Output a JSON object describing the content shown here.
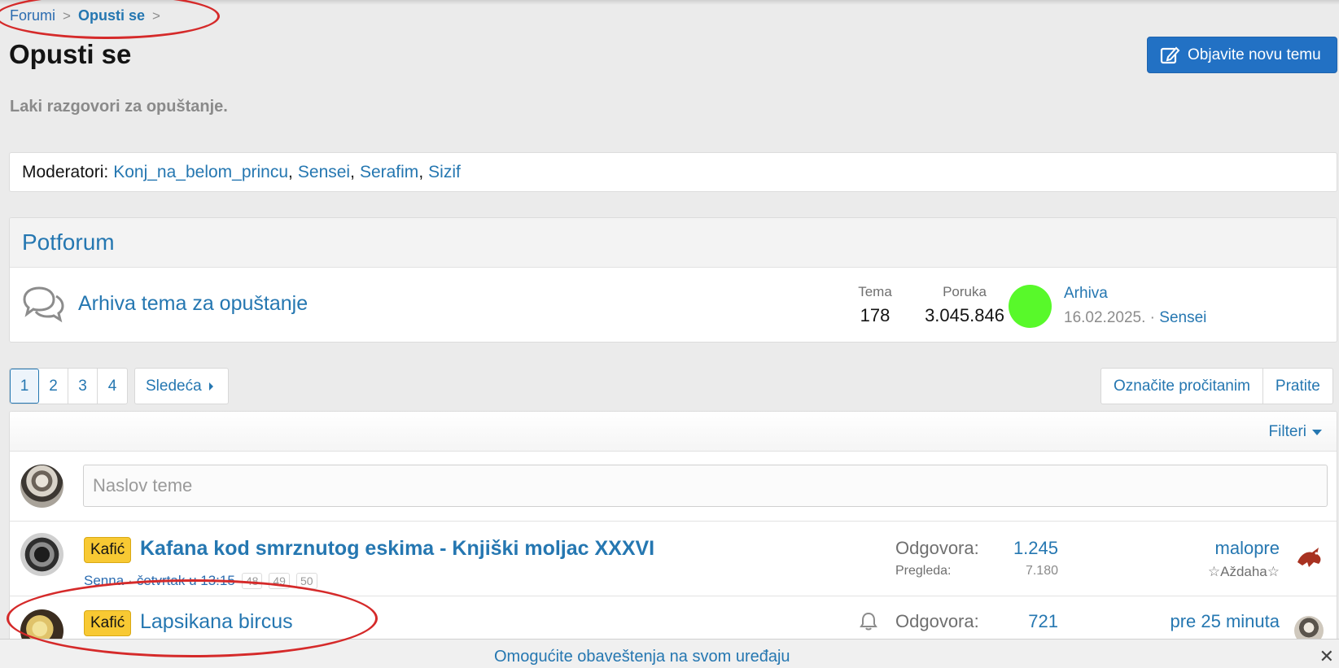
{
  "breadcrumb": {
    "root": "Forumi",
    "current": "Opusti se",
    "separator": ">"
  },
  "page": {
    "title": "Opusti se",
    "new_topic_label": "Objavite novu temu",
    "description": "Laki razgovori za opuštanje."
  },
  "moderators": {
    "label": "Moderatori:",
    "names": [
      "Konj_na_belom_princu",
      "Sensei",
      "Serafim",
      "Sizif"
    ]
  },
  "subforum": {
    "heading": "Potforum",
    "node": {
      "title": "Arhiva tema za opuštanje",
      "tema_label": "Tema",
      "tema_value": "178",
      "poruka_label": "Poruka",
      "poruka_value": "3.045.846",
      "last_title": "Arhiva",
      "last_date": "16.02.2025.",
      "last_user": "Sensei"
    }
  },
  "pagination": {
    "pages": [
      "1",
      "2",
      "3",
      "4"
    ],
    "active": "1",
    "next_label": "Sledeća"
  },
  "actions": {
    "mark_read": "Označite pročitanim",
    "follow": "Pratite"
  },
  "filters": {
    "label": "Filteri"
  },
  "new_thread": {
    "placeholder": "Naslov teme"
  },
  "threads": [
    {
      "prefix": "Kafić",
      "title": "Kafana kod smrznutog eskima - Knjiški moljac XXXVI",
      "author": "Senna",
      "date": "četvrtak u 13:15",
      "mini_pages": [
        "48",
        "49",
        "50"
      ],
      "replies_label": "Odgovora:",
      "replies": "1.245",
      "views_label": "Pregleda:",
      "views": "7.180",
      "last_time": "malopre",
      "last_user": "☆Aždaha☆"
    },
    {
      "prefix": "Kafić",
      "title": "Lapsikana bircus",
      "replies_label": "Odgovora:",
      "replies": "721",
      "last_time": "pre 25 minuta"
    }
  ],
  "notification_bar": {
    "text": "Omogućite obaveštenja na svom uređaju",
    "close": "✕"
  },
  "colors": {
    "link": "#2577b1",
    "button": "#2271c4",
    "prefix": "#f8c933",
    "avatar_green": "#58f92a",
    "annotation": "#d52a2a"
  }
}
